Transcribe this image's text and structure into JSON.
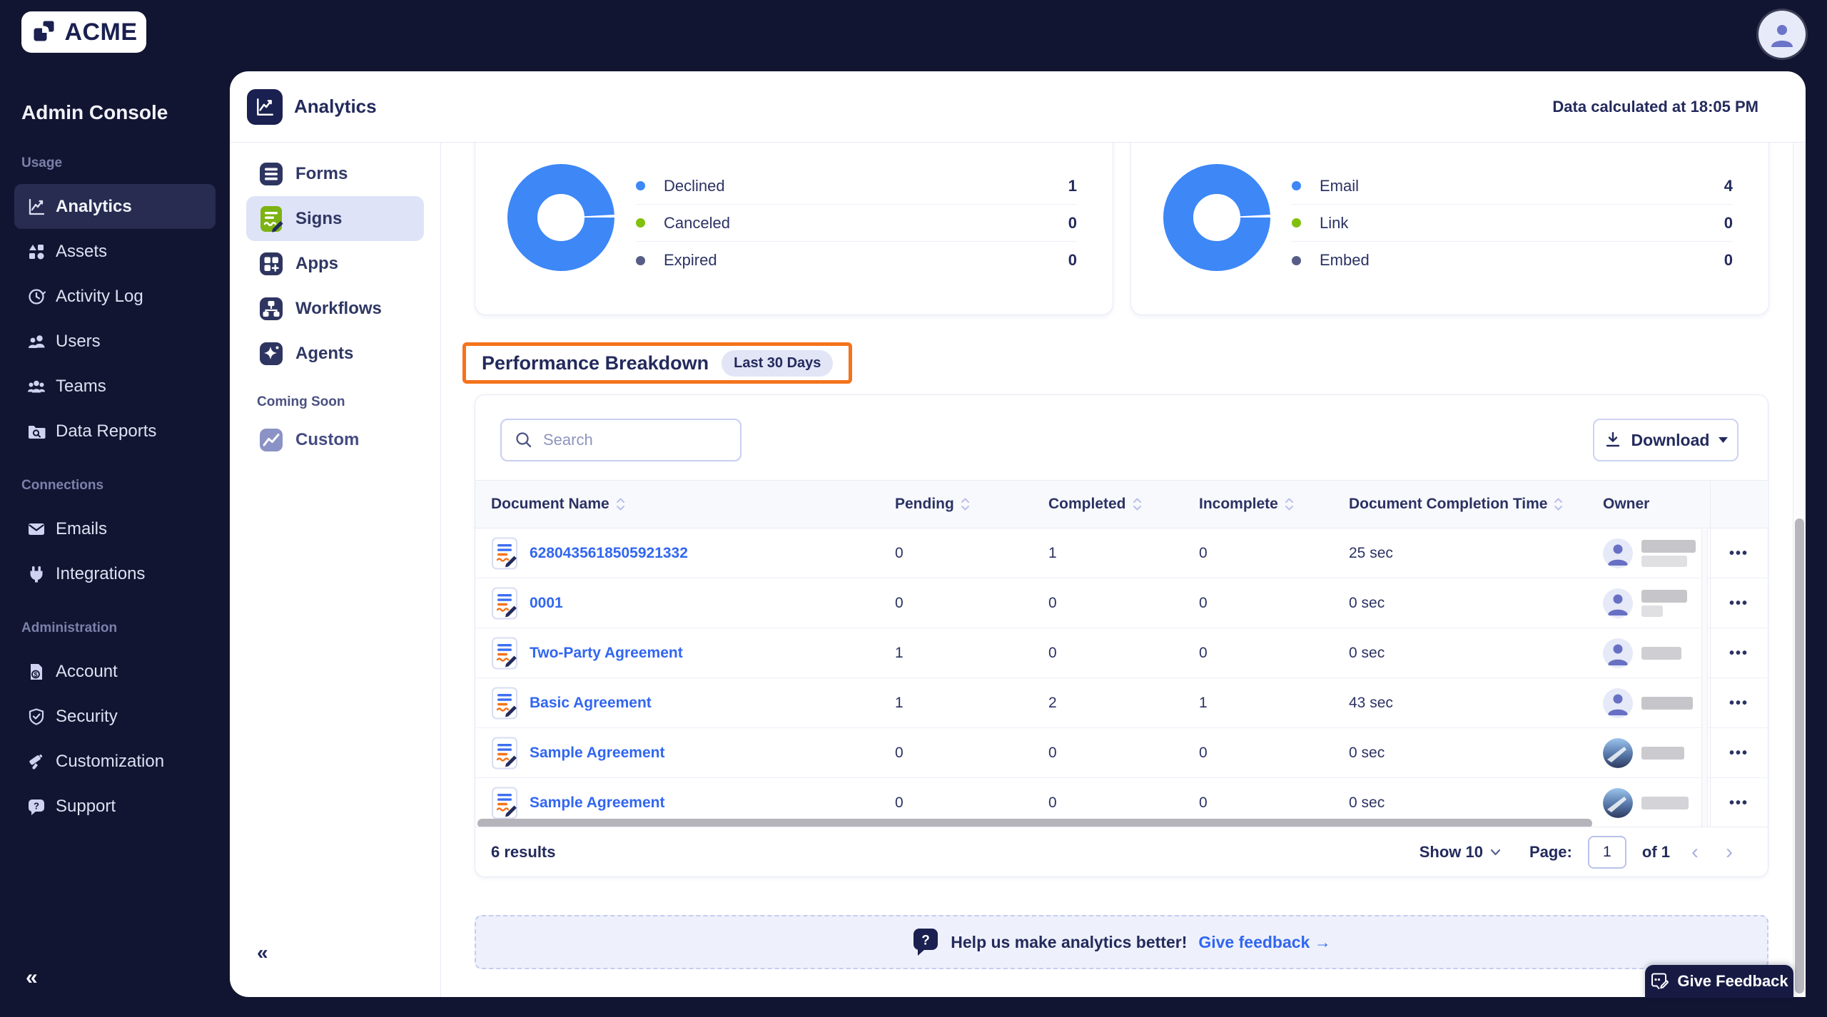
{
  "topbar": {
    "logo_text": "ACME"
  },
  "sidebar": {
    "title": "Admin Console",
    "collapse_icon": "«",
    "sections": [
      {
        "label": "Usage",
        "items": [
          {
            "label": "Analytics",
            "active": true
          },
          {
            "label": "Assets"
          },
          {
            "label": "Activity Log"
          },
          {
            "label": "Users"
          },
          {
            "label": "Teams"
          },
          {
            "label": "Data Reports"
          }
        ]
      },
      {
        "label": "Connections",
        "items": [
          {
            "label": "Emails"
          },
          {
            "label": "Integrations"
          }
        ]
      },
      {
        "label": "Administration",
        "items": [
          {
            "label": "Account"
          },
          {
            "label": "Security"
          },
          {
            "label": "Customization"
          },
          {
            "label": "Support"
          }
        ]
      }
    ]
  },
  "header": {
    "title": "Analytics",
    "status": "Data calculated at 18:05 PM"
  },
  "subnav": {
    "items": [
      {
        "label": "Forms"
      },
      {
        "label": "Signs",
        "active": true
      },
      {
        "label": "Apps"
      },
      {
        "label": "Workflows"
      },
      {
        "label": "Agents"
      }
    ],
    "coming_soon_label": "Coming Soon",
    "coming_soon_items": [
      {
        "label": "Custom"
      }
    ],
    "collapse_icon": "«"
  },
  "chart_data": [
    {
      "type": "pie",
      "categories": [
        "Declined",
        "Canceled",
        "Expired"
      ],
      "values": [
        1,
        0,
        0
      ],
      "colors": [
        "#3d87f7",
        "#82c00c",
        "#575d86"
      ],
      "legend_position": "right",
      "grid": false
    },
    {
      "type": "pie",
      "categories": [
        "Email",
        "Link",
        "Embed"
      ],
      "values": [
        4,
        0,
        0
      ],
      "colors": [
        "#3d87f7",
        "#82c00c",
        "#575d86"
      ],
      "legend_position": "right",
      "grid": false
    }
  ],
  "performance": {
    "title": "Performance Breakdown",
    "badge": "Last 30 Days",
    "highlight_color": "#f4731c"
  },
  "toolbar": {
    "search_placeholder": "Search",
    "download_label": "Download"
  },
  "table": {
    "columns": [
      {
        "label": "Document Name",
        "sortable": true
      },
      {
        "label": "Pending",
        "sortable": true
      },
      {
        "label": "Completed",
        "sortable": true
      },
      {
        "label": "Incomplete",
        "sortable": true
      },
      {
        "label": "Document Completion Time",
        "sortable": true
      },
      {
        "label": "Owner",
        "sortable": false
      }
    ],
    "rows": [
      {
        "name": "6280435618505921332",
        "pending": "0",
        "completed": "1",
        "incomplete": "0",
        "completion_time": "25 sec",
        "owner_avatar": "person"
      },
      {
        "name": "0001",
        "pending": "0",
        "completed": "0",
        "incomplete": "0",
        "completion_time": "0 sec",
        "owner_avatar": "person"
      },
      {
        "name": "Two-Party Agreement",
        "pending": "1",
        "completed": "0",
        "incomplete": "0",
        "completion_time": "0 sec",
        "owner_avatar": "person"
      },
      {
        "name": "Basic Agreement",
        "pending": "1",
        "completed": "2",
        "incomplete": "1",
        "completion_time": "43 sec",
        "owner_avatar": "person"
      },
      {
        "name": "Sample Agreement",
        "pending": "0",
        "completed": "0",
        "incomplete": "0",
        "completion_time": "0 sec",
        "owner_avatar": "photo"
      },
      {
        "name": "Sample Agreement",
        "pending": "0",
        "completed": "0",
        "incomplete": "0",
        "completion_time": "0 sec",
        "owner_avatar": "photo"
      }
    ],
    "row_actions_icon": "•••"
  },
  "pagination": {
    "results_text": "6 results",
    "show_label": "Show 10",
    "page_label": "Page:",
    "page_value": "1",
    "of_label": "of 1",
    "prev_icon": "‹",
    "next_icon": "›"
  },
  "feedback_banner": {
    "text": "Help us make analytics better!",
    "link_label": "Give feedback →"
  },
  "feedback_button": {
    "label": "Give Feedback"
  },
  "colors": {
    "link_blue": "#3166f0",
    "donut_blue": "#3d87f7",
    "lime_green": "#82c00c",
    "slate": "#575d86",
    "highlight_orange": "#f4731c",
    "navy_bg": "#121531"
  }
}
